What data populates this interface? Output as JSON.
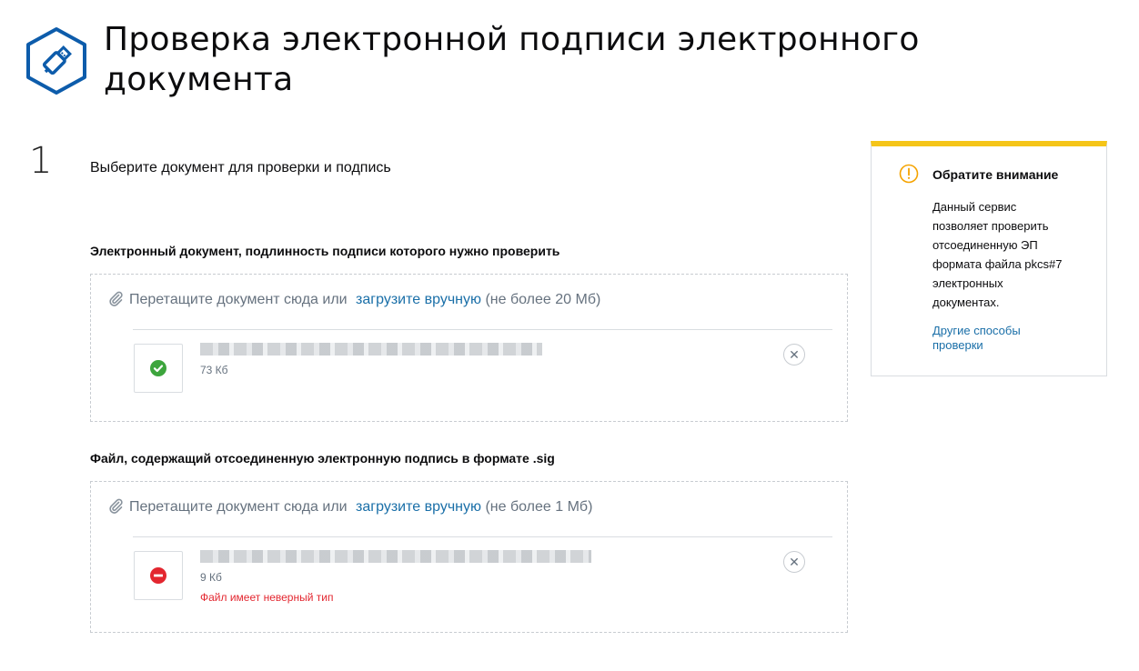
{
  "page": {
    "title": "Проверка электронной подписи электронного документа"
  },
  "step": {
    "number": "1",
    "title": "Выберите документ для проверки и подпись"
  },
  "document_section": {
    "label": "Электронный документ, подлинность подписи которого нужно проверить",
    "drop_text": "Перетащите документ сюда или",
    "upload_link": "загрузите вручную",
    "limit": "(не более 20 Мб)",
    "file": {
      "status": "valid",
      "size": "73 Кб",
      "error": ""
    }
  },
  "signature_section": {
    "label": "Файл, содержащий отсоединенную электронную подпись в формате .sig",
    "drop_text": "Перетащите документ сюда или",
    "upload_link": "загрузите вручную",
    "limit": "(не более 1 Мб)",
    "file": {
      "status": "invalid",
      "size": "9 Кб",
      "error": "Файл имеет неверный тип"
    }
  },
  "notice": {
    "title": "Обратите внимание",
    "text": "Данный сервис\nпозволяет проверить\nотсоединенную ЭП\nформата файла pkcs#7\nэлектронных\nдокументах.",
    "link": "Другие способы\nпроверки"
  },
  "colors": {
    "brand_blue": "#0d5cab",
    "link": "#1a6fa8",
    "success": "#3da53d",
    "error": "#e3262f",
    "notice_accent": "#f5c518"
  },
  "icons": {
    "logo": "usb-key-icon",
    "attach": "paperclip-icon",
    "valid": "check-circle-icon",
    "invalid": "no-entry-icon",
    "remove": "close-icon",
    "notice": "exclamation-circle-icon"
  }
}
